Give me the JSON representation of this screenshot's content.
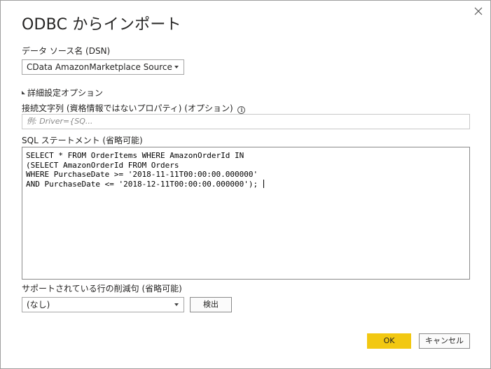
{
  "dialog": {
    "title": "ODBC からインポート"
  },
  "dsn": {
    "label": "データ ソース名 (DSN)",
    "selected": "CData AmazonMarketplace Source"
  },
  "advanced": {
    "toggle_label": "詳細設定オプション",
    "connection_label": "接続文字列 (資格情報ではないプロパティ) (オプション)",
    "info_glyph": "i",
    "connection_placeholder": "例: Driver={SQ...",
    "sql_label": "SQL ステートメント (省略可能)",
    "sql_lines": [
      "SELECT * FROM OrderItems WHERE AmazonOrderId IN",
      "(SELECT AmazonOrderId FROM Orders",
      "WHERE PurchaseDate >= '2018-11-11T00:00:00.000000'",
      "AND PurchaseDate <= '2018-12-11T00:00:00.000000');"
    ],
    "row_reduction_label": "サポートされている行の削減句 (省略可能)",
    "row_reduction_selected": "(なし)",
    "detect_button": "検出"
  },
  "footer": {
    "ok_label": "OK",
    "cancel_label": "キャンセル"
  },
  "colors": {
    "ok_accent": "#f2c811"
  },
  "icons": {
    "close": "close-icon",
    "dropdown": "chevron-down-icon",
    "expand": "triangle-expanded-icon",
    "info": "info-icon"
  }
}
